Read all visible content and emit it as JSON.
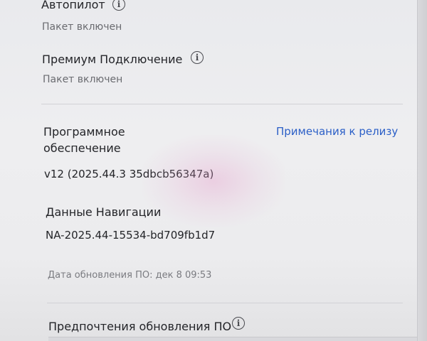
{
  "autopilot": {
    "title": "Автопилот",
    "status": "Пакет включен"
  },
  "premium": {
    "title": "Премиум Подключение",
    "status": "Пакет включен"
  },
  "software": {
    "title_line1": "Программное",
    "title_line2": "обеспечение",
    "release_notes_link": "Примечания к релизу",
    "version": "v12 (2025.44.3 35dbcb56347a)"
  },
  "navigation": {
    "title": "Данные Навигации",
    "version": "NA-2025.44-15534-bd709fb1d7"
  },
  "update_date": "Дата обновления ПО: дек 8 09:53",
  "update_prefs": {
    "title": "Предпочтения обновления ПО"
  },
  "icons": {
    "info": "info-icon"
  },
  "colors": {
    "link": "#2b5fc7",
    "text": "#232428",
    "muted": "#6a6b70"
  }
}
